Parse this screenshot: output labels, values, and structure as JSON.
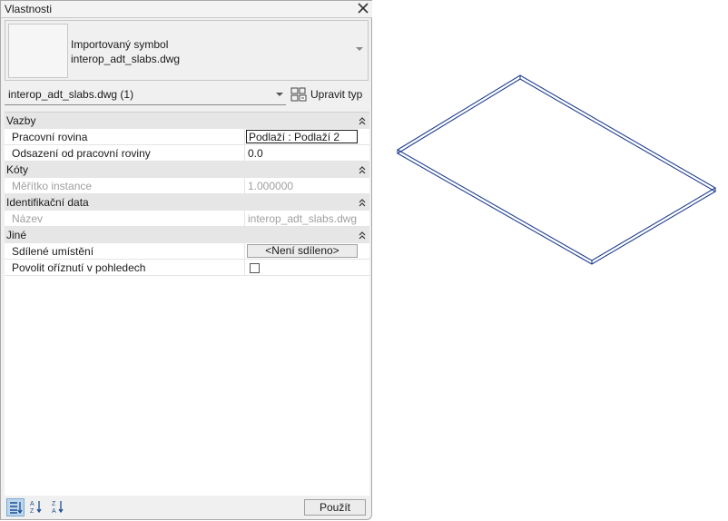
{
  "panel": {
    "title": "Vlastnosti",
    "type_selector": {
      "line1": "Importovaný symbol",
      "line2": "interop_adt_slabs.dwg"
    },
    "instance_filter": "interop_adt_slabs.dwg (1)",
    "edit_type_label": "Upravit typ"
  },
  "groups": [
    {
      "name": "Vazby"
    },
    {
      "name": "Kóty"
    },
    {
      "name": "Identifikační data"
    },
    {
      "name": "Jiné"
    }
  ],
  "rows": [
    {
      "label": "Pracovní rovina",
      "value": "Podlaží : Podlaží 2"
    },
    {
      "label": "Odsazení od pracovní roviny",
      "value": "0.0"
    },
    {
      "label": "Měřítko instance",
      "value": "1.000000"
    },
    {
      "label": "Název",
      "value": "interop_adt_slabs.dwg"
    },
    {
      "label": "Sdílené umístění",
      "value": "<Není sdíleno>"
    },
    {
      "label": "Povolit oříznutí v pohledech",
      "value": ""
    }
  ],
  "footer": {
    "apply_label": "Použít"
  },
  "colors": {
    "selection_blue": "#bcd6ee",
    "model_edge": "#1f3f8f"
  }
}
